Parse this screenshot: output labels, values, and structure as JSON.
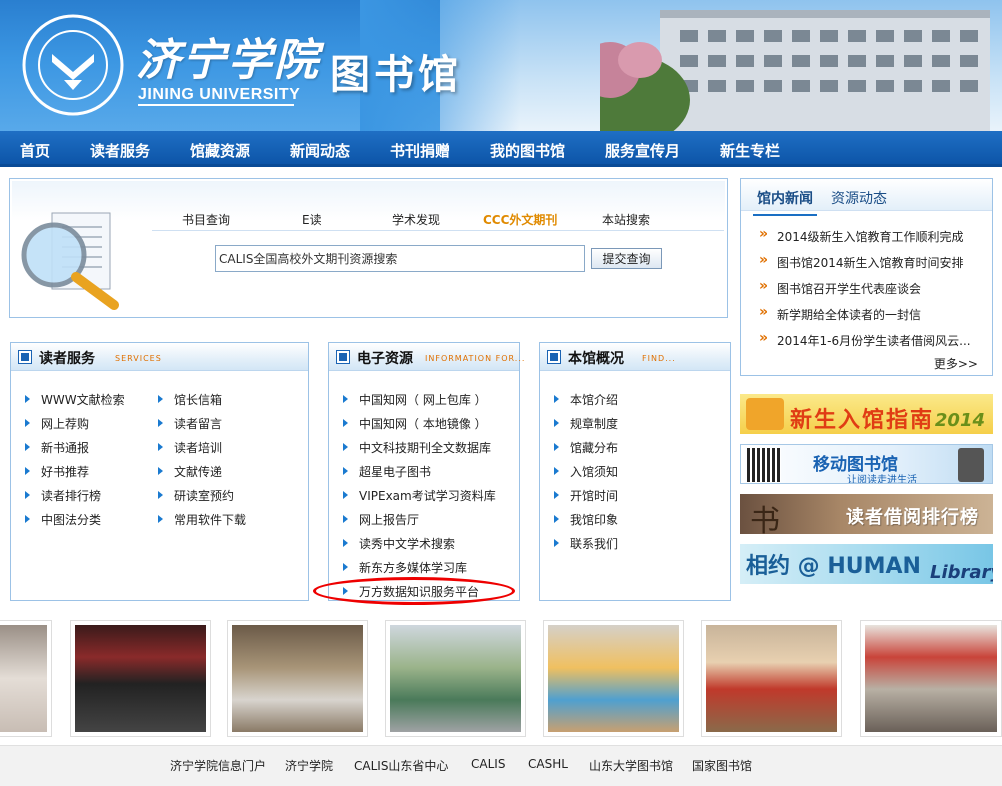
{
  "header": {
    "brand_cn": "济宁学院",
    "brand_en": "JINING UNIVERSITY",
    "library_title": "图书馆",
    "logo_text": "JINING UNIVERSITY"
  },
  "nav": {
    "items": [
      "首页",
      "读者服务",
      "馆藏资源",
      "新闻动态",
      "书刊捐赠",
      "我的图书馆",
      "服务宣传月",
      "新生专栏"
    ]
  },
  "search": {
    "tabs": [
      "书目查询",
      "E读",
      "学术发现",
      "CCC外文期刊",
      "本站搜索"
    ],
    "active_tab": "CCC外文期刊",
    "input_value": "CALIS全国高校外文期刊资源搜索",
    "button_label": "提交查询"
  },
  "news": {
    "tab_active": "馆内新闻",
    "tab_other": "资源动态",
    "items": [
      "2014级新生入馆教育工作顺利完成",
      "图书馆2014新生入馆教育时间安排",
      "图书馆召开学生代表座谈会",
      "新学期给全体读者的一封信",
      "2014年1-6月份学生读者借阅风云..."
    ],
    "more": "更多>>"
  },
  "banners": {
    "b1_text": "新生入馆指南",
    "b1_year": "2014",
    "b2_text": "移动图书馆",
    "b2_sub": "让阅读走进生活",
    "b3_char": "书",
    "b3_text": "读者借阅排行榜",
    "b4_text1": "相约 @ HUMAN",
    "b4_text2": "Library"
  },
  "reader_services": {
    "title": "读者服务",
    "title_en": "SERVICES",
    "col1": [
      "WWW文献检索",
      "网上荐购",
      "新书通报",
      "好书推荐",
      "读者排行榜",
      "中图法分类"
    ],
    "col2": [
      "馆长信箱",
      "读者留言",
      "读者培训",
      "文献传递",
      "研读室预约",
      "常用软件下载"
    ]
  },
  "e_resources": {
    "title": "电子资源",
    "title_en": "INFORMATION FOR...",
    "items": [
      "中国知网（ 网上包库 ）",
      "中国知网（ 本地镜像 ）",
      "中文科技期刊全文数据库",
      "超星电子图书",
      "VIPExam考试学习资料库",
      "网上报告厅",
      "读秀中文学术搜索",
      "新东方多媒体学习库",
      "万方数据知识服务平台"
    ]
  },
  "about": {
    "title": "本馆概况",
    "title_en": "FIND...",
    "items": [
      "本馆介绍",
      "规章制度",
      "馆藏分布",
      "入馆须知",
      "开馆时间",
      "我馆印象",
      "联系我们"
    ]
  },
  "footer": {
    "links": [
      "济宁学院信息门户",
      "济宁学院",
      "CALIS山东省中心",
      "CALIS",
      "CASHL",
      "山东大学图书馆",
      "国家图书馆"
    ]
  }
}
